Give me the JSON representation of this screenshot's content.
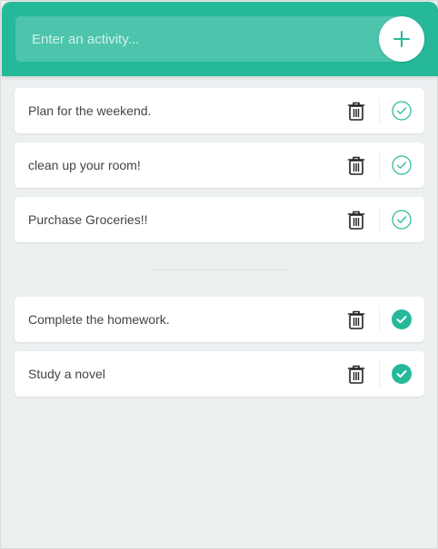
{
  "header": {
    "input_placeholder": "Enter an activity...",
    "input_value": "",
    "add_icon": "plus-icon"
  },
  "todo": [
    {
      "label": "Plan for the weekend.",
      "completed": false
    },
    {
      "label": "clean up your room!",
      "completed": false
    },
    {
      "label": "Purchase Groceries!!",
      "completed": false
    }
  ],
  "completed": [
    {
      "label": "Complete the homework.",
      "completed": true
    },
    {
      "label": "Study a novel",
      "completed": true
    }
  ],
  "icons": {
    "remove": "trash-icon",
    "complete": "check-circle-icon"
  },
  "colors": {
    "accent": "#25b99a",
    "background": "#edf0f1",
    "text": "#444444",
    "trash": "#222222"
  }
}
